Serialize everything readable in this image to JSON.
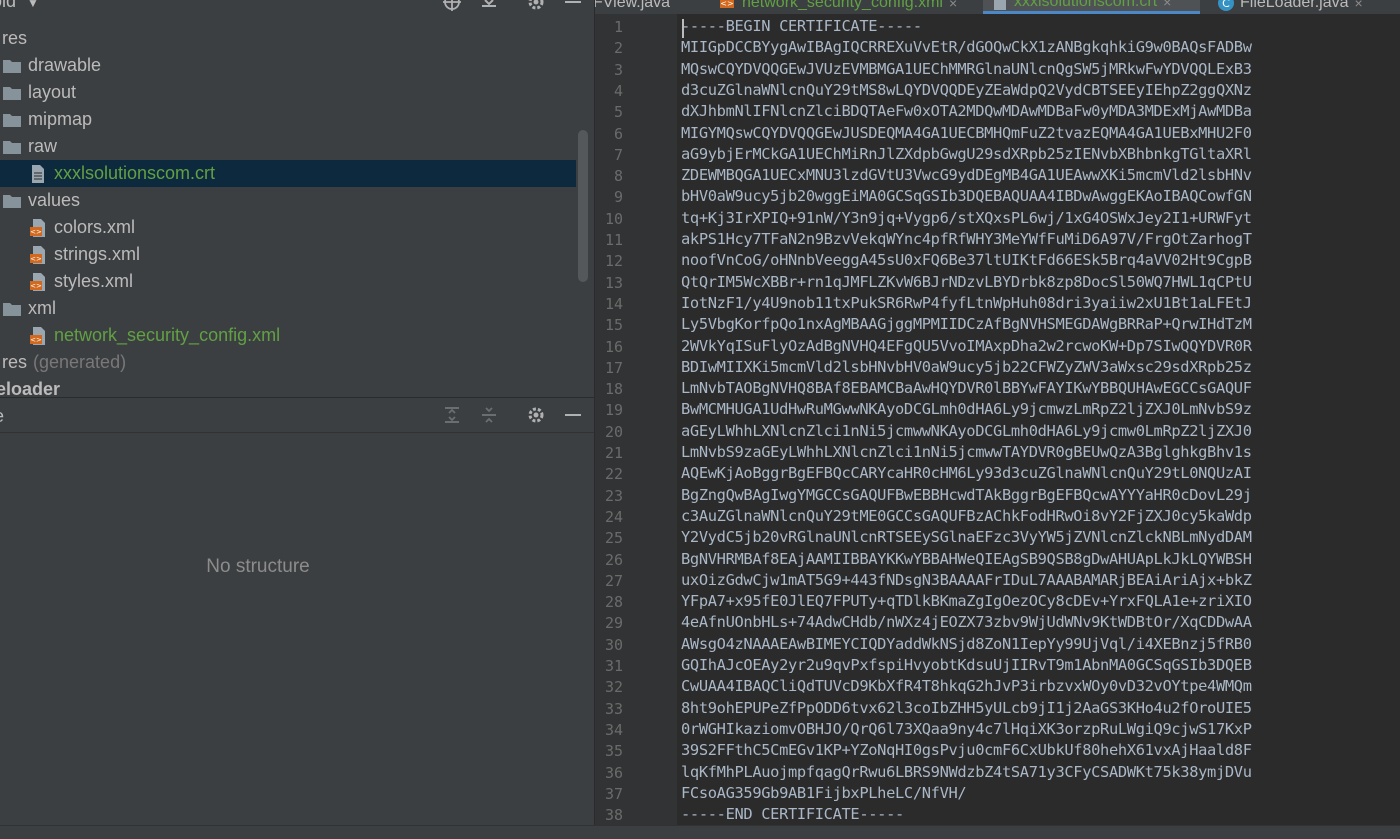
{
  "project_panel": {
    "title": "old",
    "title_arrow": "chevron-down-icon"
  },
  "tree": [
    {
      "label": "res",
      "icon": "",
      "style": ""
    },
    {
      "label": "drawable",
      "icon": "folder-icon",
      "style": ""
    },
    {
      "label": "layout",
      "icon": "folder-icon",
      "style": ""
    },
    {
      "label": "mipmap",
      "icon": "folder-icon",
      "style": ""
    },
    {
      "label": "raw",
      "icon": "folder-icon",
      "style": ""
    },
    {
      "label": "xxxlsolutionscom.crt",
      "icon": "file-icon",
      "style": "green",
      "selected": true
    },
    {
      "label": "values",
      "icon": "folder-icon",
      "style": ""
    },
    {
      "label": "colors.xml",
      "icon": "xml-file-icon",
      "style": ""
    },
    {
      "label": "strings.xml",
      "icon": "xml-file-icon",
      "style": ""
    },
    {
      "label": "styles.xml",
      "icon": "xml-file-icon",
      "style": ""
    },
    {
      "label": "xml",
      "icon": "folder-icon",
      "style": ""
    },
    {
      "label": "network_security_config.xml",
      "icon": "xml-file-icon",
      "style": "green"
    },
    {
      "label": "res",
      "suffix": "(generated)",
      "icon": "",
      "style": ""
    },
    {
      "label": "eloader",
      "icon": "",
      "style": "bold"
    }
  ],
  "structure_panel": {
    "title": "e",
    "empty_text": "No structure"
  },
  "tabs": [
    {
      "label": "FView.java",
      "icon": "",
      "style": ""
    },
    {
      "label": "network_security_config.xml",
      "icon": "xml-file-icon",
      "style": "green",
      "close": "×"
    },
    {
      "label": "xxxlsolutionscom.crt",
      "icon": "file-icon",
      "style": "green",
      "active": true,
      "close": "×"
    },
    {
      "label": "FileLoader.java",
      "icon": "class-icon",
      "style": "",
      "close": "×"
    }
  ],
  "colors": {
    "panel_bg": "#3c3f41",
    "editor_bg": "#2b2b2b",
    "selection_bg": "#0d293e",
    "vcs_added": "#62a044",
    "accent": "#4a88c7"
  },
  "code_lines": [
    "-----BEGIN CERTIFICATE-----",
    "MIIGpDCCBYygAwIBAgIQCRREXuVvEtR/dGOQwCkX1zANBgkqhkiG9w0BAQsFADBw",
    "MQswCQYDVQQGEwJVUzEVMBMGA1UEChMMRGlnaUNlcnQgSW5jMRkwFwYDVQQLExB3",
    "d3cuZGlnaWNlcnQuY29tMS8wLQYDVQQDEyZEaWdpQ2VydCBTSEEyIEhpZ2ggQXNz",
    "dXJhbmNlIFNlcnZlciBDQTAeFw0xOTA2MDQwMDAwMDBaFw0yMDA3MDExMjAwMDBa",
    "MIGYMQswCQYDVQQGEwJUSDEQMA4GA1UECBMHQmFuZ2tvazEQMA4GA1UEBxMHU2F0",
    "aG9ybjErMCkGA1UEChMiRnJlZXdpbGwgU29sdXRpb25zIENvbXBhbnkgTGltaXRl",
    "ZDEWMBQGA1UECxMNU3lzdGVtU3VwcG9ydDEgMB4GA1UEAwwXKi5mcmVld2lsbHNv",
    "bHV0aW9ucy5jb20wggEiMA0GCSqGSIb3DQEBAQUAA4IBDwAwggEKAoIBAQCowfGN",
    "tq+Kj3IrXPIQ+91nW/Y3n9jq+Vygp6/stXQxsPL6wj/1xG4OSWxJey2I1+URWFyt",
    "akPS1Hcy7TFaN2n9BzvVekqWYnc4pfRfWHY3MeYWfFuMiD6A97V/FrgOtZarhogT",
    "noofVnCoG/oHNnbVeeggA45sU0xFQ6Be37ltUIKtFd66ESk5Brq4aVV02Ht9CgpB",
    "QtQrIM5WcXBBr+rn1qJMFLZKvW6BJrNDzvLBYDrbk8zp8DocSl50WQ7HWL1qCPtU",
    "IotNzF1/y4U9nob11txPukSR6RwP4fyfLtnWpHuh08dri3yaiiw2xU1Bt1aLFEtJ",
    "Ly5VbgKorfpQo1nxAgMBAAGjggMPMIIDCzAfBgNVHSMEGDAWgBRRaP+QrwIHdTzM",
    "2WVkYqISuFlyOzAdBgNVHQ4EFgQU5VvoIMAxpDha2w2rcwoKW+Dp7SIwQQYDVR0R",
    "BDIwMIIXKi5mcmVld2lsbHNvbHV0aW9ucy5jb22CFWZyZWV3aWxsc29sdXRpb25z",
    "LmNvbTAOBgNVHQ8BAf8EBAMCBaAwHQYDVR0lBBYwFAYIKwYBBQUHAwEGCCsGAQUF",
    "BwMCMHUGA1UdHwRuMGwwNKAyoDCGLmh0dHA6Ly9jcmwzLmRpZ2ljZXJ0LmNvbS9z",
    "aGEyLWhhLXNlcnZlci1nNi5jcmwwNKAyoDCGLmh0dHA6Ly9jcmw0LmRpZ2ljZXJ0",
    "LmNvbS9zaGEyLWhhLXNlcnZlci1nNi5jcmwwTAYDVR0gBEUwQzA3BglghkgBhv1s",
    "AQEwKjAoBggrBgEFBQcCARYcaHR0cHM6Ly93d3cuZGlnaWNlcnQuY29tL0NQUzAI",
    "BgZngQwBAgIwgYMGCCsGAQUFBwEBBHcwdTAkBggrBgEFBQcwAYYYaHR0cDovL29j",
    "c3AuZGlnaWNlcnQuY29tME0GCCsGAQUFBzAChkFodHRwOi8vY2FjZXJ0cy5kaWdp",
    "Y2VydC5jb20vRGlnaUNlcnRTSEEySGlnaEFzc3VyYW5jZVNlcnZlckNBLmNydDAM",
    "BgNVHRMBAf8EAjAAMIIBBAYKKwYBBAHWeQIEAgSB9QSB8gDwAHUApLkJkLQYWBSH",
    "uxOizGdwCjw1mAT5G9+443fNDsgN3BAAAAFrIDuL7AAABAMARjBEAiAriAjx+bkZ",
    "YFpA7+x95fE0JlEQ7FPUTy+qTDlkBKmaZgIgOezOCy8cDEv+YrxFQLA1e+zriXIO",
    "4eAfnUOnbHLs+74AdwCHdb/nWXz4jEOZX73zbv9WjUdWNv9KtWDBtOr/XqCDDwAA",
    "AWsgO4zNAAAEAwBIMEYCIQDYaddWkNSjd8ZoN1IepYy99UjVql/i4XEBnzj5fRB0",
    "GQIhAJcOEAy2yr2u9qvPxfspiHvyobtKdsuUjIIRvT9m1AbnMA0GCSqGSIb3DQEB",
    "CwUAA4IBAQCliQdTUVcD9KbXfR4T8hkqG2hJvP3irbzvxWOy0vD32vOYtpe4WMQm",
    "8ht9ohEPUPeZfPpODD6tvx62l3coIbZHH5yULcb9jI1j2AaGS3KHo4u2fOroUIE5",
    "0rWGHIkaziomvOBHJO/QrQ6l73XQaa9ny4c7lHqiXK3orzpRuLWgiQ9cjwS17KxP",
    "39S2FFthC5CmEGv1KP+YZoNqHI0gsPvju0cmF6CxUbkUf80hehX61vxAjHaald8F",
    "lqKfMhPLAuojmpfqagQrRwu6LBRS9NWdzbZ4tSA71y3CFyCSADWKt75k38ymjDVu",
    "FCsoAG359Gb9AB1FijbxPLheLC/NfVH/",
    "-----END CERTIFICATE-----"
  ]
}
